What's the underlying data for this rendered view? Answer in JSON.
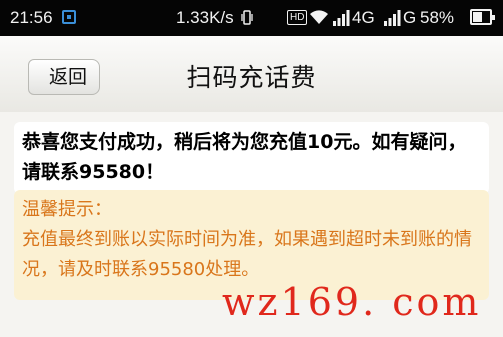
{
  "status_bar": {
    "time": "21:56",
    "net_speed": "1.33K/s",
    "hd_label": "HD",
    "network_1": "4G",
    "network_2": "G",
    "battery": "58%",
    "battery_level": 0.58
  },
  "nav": {
    "back_label": "返回",
    "title": "扫码充话费"
  },
  "success": {
    "message": "恭喜您支付成功，稍后将为您充值10元。如有疑问，请联系95580！"
  },
  "tip": {
    "title": "温馨提示：",
    "body": "充值最终到账以实际时间为准，如果遇到超时未到账的情况，请及时联系95580处理。"
  },
  "watermark": "wz169. com",
  "colors": {
    "tip_text": "#d9761b",
    "tip_bg": "#fbf1d3",
    "watermark": "#e0281c"
  }
}
